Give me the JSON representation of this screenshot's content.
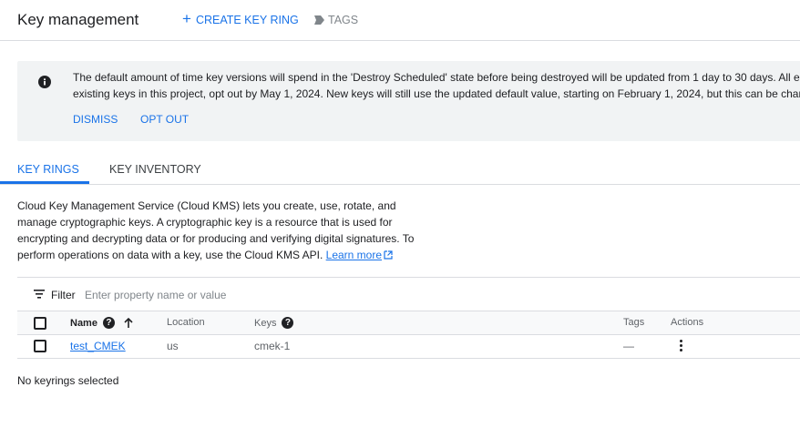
{
  "header": {
    "title": "Key management",
    "create_label": "CREATE KEY RING",
    "tags_label": "TAGS"
  },
  "banner": {
    "line1": "The default amount of time key versions will spend in the 'Destroy Scheduled' state before being destroyed will be updated from 1 day to 30 days. All existin",
    "line2": "existing keys in this project, opt out by May 1, 2024. New keys will still use the updated default value, starting on February 1, 2024, but this can be changed",
    "dismiss_label": "DISMISS",
    "optout_label": "OPT OUT"
  },
  "tabs": [
    {
      "label": "KEY RINGS",
      "active": true
    },
    {
      "label": "KEY INVENTORY",
      "active": false
    }
  ],
  "description": {
    "text": "Cloud Key Management Service (Cloud KMS) lets you create, use, rotate, and manage cryptographic keys. A cryptographic key is a resource that is used for encrypting and decrypting data or for producing and verifying digital signatures. To perform operations on data with a key, use the Cloud KMS API.",
    "link_label": "Learn more"
  },
  "filter": {
    "label": "Filter",
    "placeholder": "Enter property name or value"
  },
  "table": {
    "columns": {
      "name": "Name",
      "location": "Location",
      "keys": "Keys",
      "tags": "Tags",
      "actions": "Actions"
    },
    "rows": [
      {
        "name": "test_CMEK",
        "location": "us",
        "keys": "cmek-1",
        "tags": "—"
      }
    ]
  },
  "selection_text": "No keyrings selected",
  "colors": {
    "accent": "#1a73e8",
    "banner_bg": "#f1f3f4"
  }
}
